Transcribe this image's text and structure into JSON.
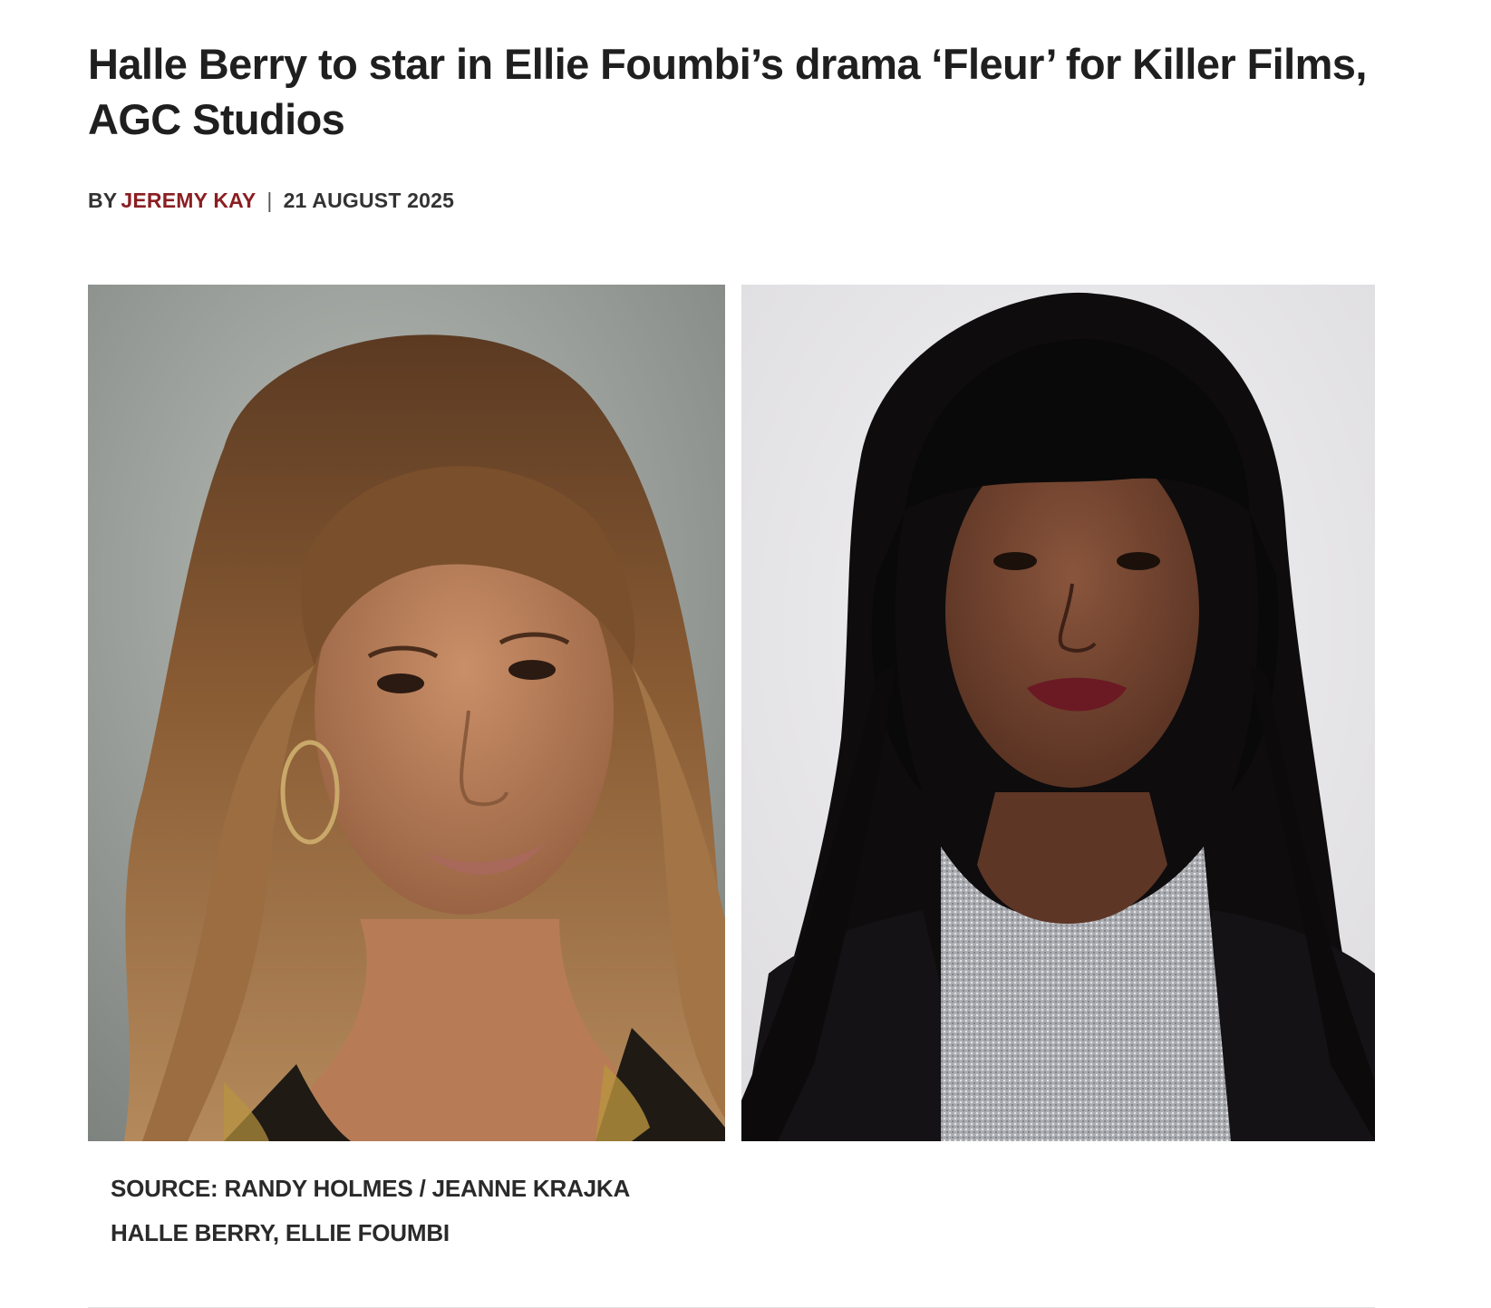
{
  "article": {
    "headline": "Halle Berry to star in Ellie Foumbi’s drama ‘Fleur’ for Killer Films, AGC Studios",
    "byline": {
      "prefix": "BY",
      "author": "JEREMY KAY",
      "separator": "|",
      "date": "21 AUGUST 2025"
    },
    "image_caption": {
      "source": "SOURCE: RANDY HOLMES / JEANNE KRAJKA",
      "subjects": "HALLE BERRY, ELLIE FOUMBI"
    }
  },
  "colors": {
    "author_link": "#8b1e22",
    "text": "#1f1f1f"
  }
}
